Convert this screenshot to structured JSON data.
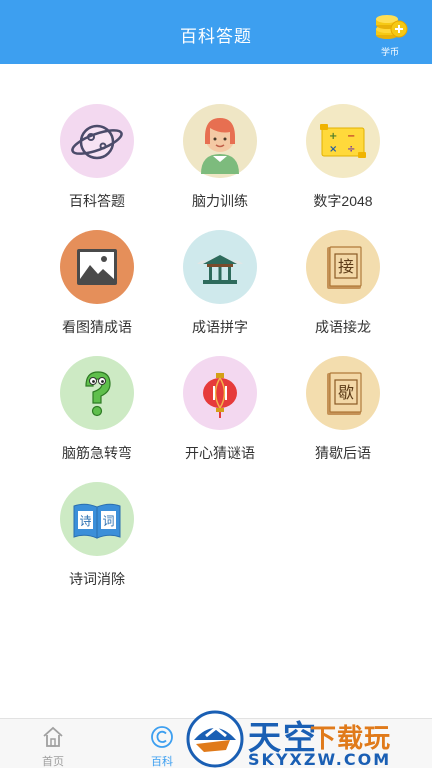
{
  "header": {
    "title": "百科答题",
    "coin_label": "学币"
  },
  "tiles": [
    {
      "label": "百科答题"
    },
    {
      "label": "脑力训练"
    },
    {
      "label": "数字2048"
    },
    {
      "label": "看图猜成语"
    },
    {
      "label": "成语拼字"
    },
    {
      "label": "成语接龙"
    },
    {
      "label": "脑筋急转弯"
    },
    {
      "label": "开心猜谜语"
    },
    {
      "label": "猜歇后语"
    },
    {
      "label": "诗词消除"
    }
  ],
  "icon_glyphs": {
    "jie": "接",
    "xie": "歇",
    "shi": "诗",
    "ci": "词"
  },
  "nav": [
    {
      "label": "首页",
      "icon": "home-icon",
      "active": false
    },
    {
      "label": "百科",
      "icon": "copyright-c-icon",
      "active": true
    }
  ],
  "watermark": {
    "main": "天空",
    "sub": "下载玩",
    "url": "SKYXZW.COM"
  },
  "colors": {
    "header": "#3d9ff0",
    "active_nav": "#3d9ff0",
    "inactive_nav": "#a0a0a0"
  }
}
